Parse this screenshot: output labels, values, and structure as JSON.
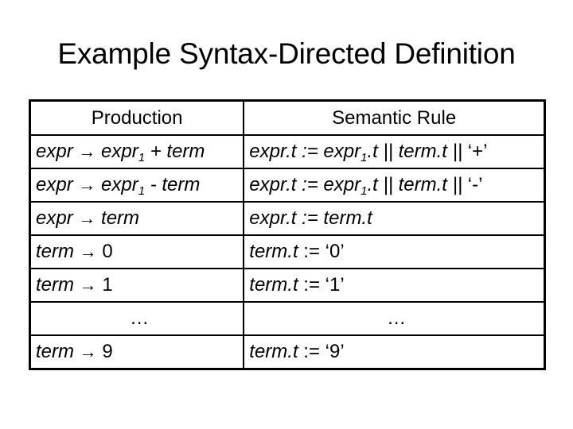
{
  "slide": {
    "title": "Example Syntax-Directed Definition"
  },
  "table": {
    "headers": [
      "Production",
      "Semantic Rule"
    ],
    "arrow_icon": "→",
    "rows": [
      {
        "production": {
          "lhs": "expr",
          "rhs_parts": [
            "expr",
            "1",
            " + term"
          ]
        },
        "rule": {
          "parts": [
            "expr.t := expr",
            "1",
            ".t || term.t || ",
            "‘+’"
          ]
        }
      },
      {
        "production": {
          "lhs": "expr",
          "rhs_parts": [
            "expr",
            "1",
            " - term"
          ]
        },
        "rule": {
          "parts": [
            "expr.t := expr",
            "1",
            ".t || term.t || ",
            "‘-’"
          ]
        }
      },
      {
        "production": {
          "lhs": "expr",
          "rhs": "term"
        },
        "rule": {
          "text": "expr.t := term.t"
        }
      },
      {
        "production": {
          "lhs": "term",
          "rhs": "0"
        },
        "rule": {
          "italic": "term.t",
          "plain": " := ‘0’"
        }
      },
      {
        "production": {
          "lhs": "term",
          "rhs": "1"
        },
        "rule": {
          "italic": "term.t",
          "plain": " := ‘1’"
        }
      },
      {
        "ellipsis": "…"
      },
      {
        "production": {
          "lhs": "term",
          "rhs": "9"
        },
        "rule": {
          "italic": "term.t",
          "plain": " := ‘9’"
        }
      }
    ]
  }
}
